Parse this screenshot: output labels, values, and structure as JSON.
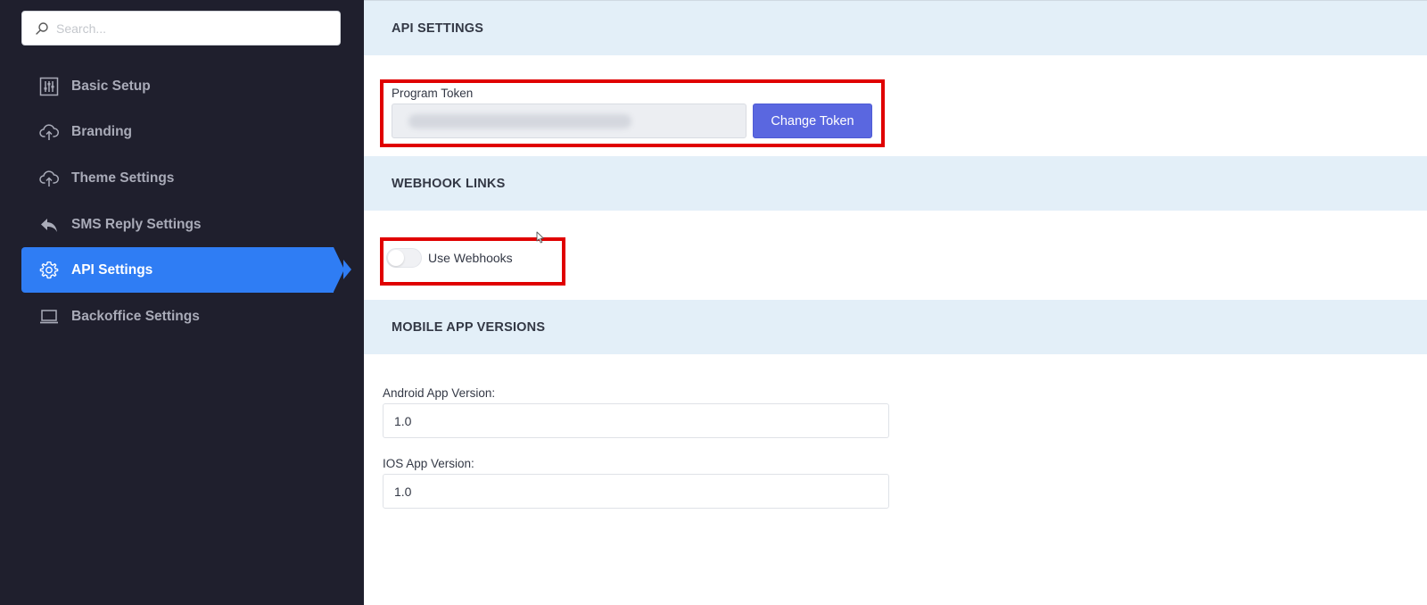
{
  "search": {
    "placeholder": "Search..."
  },
  "sidebar": {
    "items": [
      {
        "label": "Basic Setup",
        "icon": "sliders-icon"
      },
      {
        "label": "Branding",
        "icon": "cloud-upload-icon"
      },
      {
        "label": "Theme Settings",
        "icon": "cloud-upload-icon"
      },
      {
        "label": "SMS Reply Settings",
        "icon": "reply-icon"
      },
      {
        "label": "API Settings",
        "icon": "gear-icon",
        "active": true
      },
      {
        "label": "Backoffice Settings",
        "icon": "laptop-icon"
      }
    ]
  },
  "api_settings": {
    "title": "API SETTINGS",
    "token_label": "Program Token",
    "change_token_label": "Change Token"
  },
  "webhook_links": {
    "title": "WEBHOOK LINKS",
    "use_webhooks_label": "Use Webhooks",
    "use_webhooks_enabled": false
  },
  "mobile_app_versions": {
    "title": "MOBILE APP VERSIONS",
    "android_label": "Android App Version:",
    "android_value": "1.0",
    "ios_label": "IOS App Version:",
    "ios_value": "1.0"
  },
  "colors": {
    "sidebar_bg": "#1f1f2d",
    "active_item": "#2f7df4",
    "section_header_bg": "#e3eff8",
    "primary_button": "#5a67e0",
    "highlight_border": "#e00000"
  }
}
